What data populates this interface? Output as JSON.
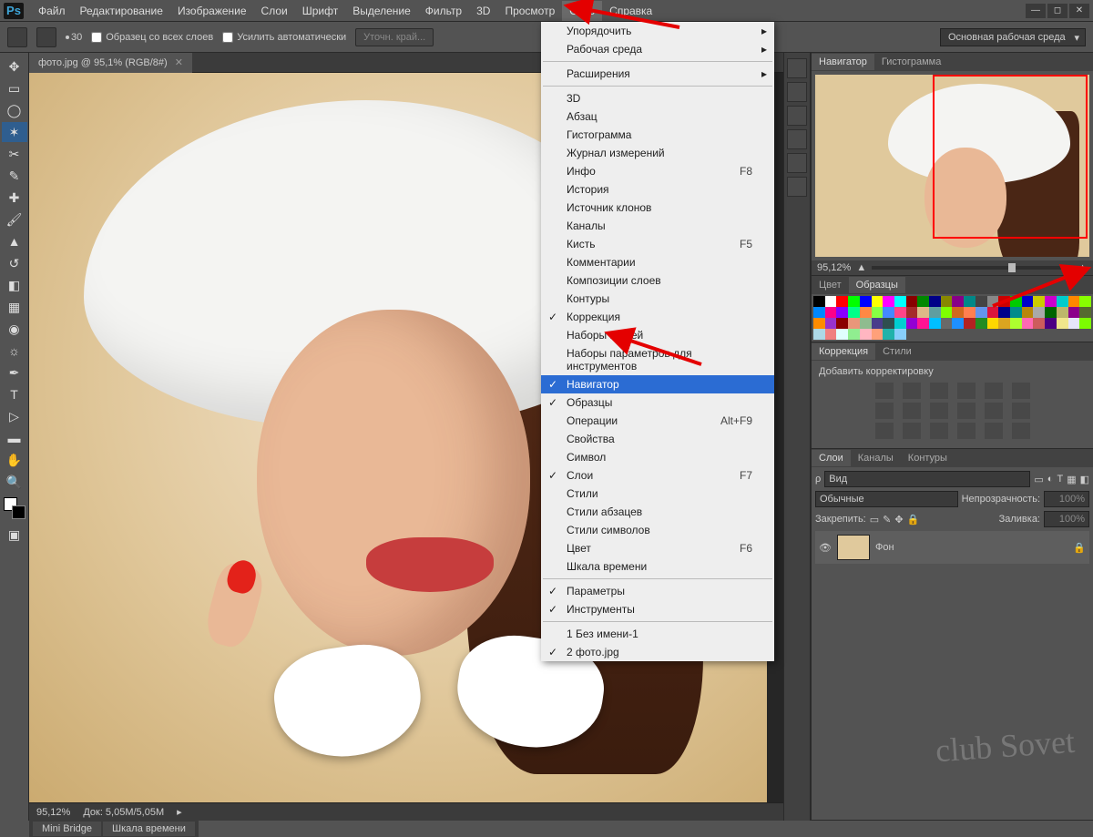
{
  "menu": [
    "Файл",
    "Редактирование",
    "Изображение",
    "Слои",
    "Шрифт",
    "Выделение",
    "Фильтр",
    "3D",
    "Просмотр",
    "Окно",
    "Справка"
  ],
  "active_menu_index": 9,
  "optbar": {
    "brush_size": "30",
    "chk1": "Образец со всех слоев",
    "chk2": "Усилить автоматически",
    "btn": "Уточн. край..."
  },
  "workspace": "Основная рабочая среда",
  "tab": {
    "title": "фото.jpg @ 95,1% (RGB/8#)"
  },
  "status": {
    "zoom": "95,12%",
    "doc": "Док:  5,05M/5,05M"
  },
  "dropdown": [
    {
      "t": "sub",
      "label": "Упорядочить"
    },
    {
      "t": "sub",
      "label": "Рабочая среда"
    },
    {
      "t": "sep"
    },
    {
      "t": "sub",
      "label": "Расширения"
    },
    {
      "t": "sep"
    },
    {
      "t": "item",
      "label": "3D"
    },
    {
      "t": "item",
      "label": "Абзац"
    },
    {
      "t": "item",
      "label": "Гистограмма"
    },
    {
      "t": "item",
      "label": "Журнал измерений"
    },
    {
      "t": "item",
      "label": "Инфо",
      "sc": "F8"
    },
    {
      "t": "item",
      "label": "История"
    },
    {
      "t": "item",
      "label": "Источник клонов"
    },
    {
      "t": "item",
      "label": "Каналы"
    },
    {
      "t": "item",
      "label": "Кисть",
      "sc": "F5"
    },
    {
      "t": "item",
      "label": "Комментарии"
    },
    {
      "t": "item",
      "label": "Композиции слоев"
    },
    {
      "t": "item",
      "label": "Контуры"
    },
    {
      "t": "chk",
      "label": "Коррекция"
    },
    {
      "t": "item",
      "label": "Наборы кистей"
    },
    {
      "t": "item",
      "label": "Наборы параметров для инструментов"
    },
    {
      "t": "hl chk",
      "label": "Навигатор"
    },
    {
      "t": "chk",
      "label": "Образцы"
    },
    {
      "t": "item",
      "label": "Операции",
      "sc": "Alt+F9"
    },
    {
      "t": "item",
      "label": "Свойства"
    },
    {
      "t": "item",
      "label": "Символ"
    },
    {
      "t": "chk",
      "label": "Слои",
      "sc": "F7"
    },
    {
      "t": "item",
      "label": "Стили"
    },
    {
      "t": "item",
      "label": "Стили абзацев"
    },
    {
      "t": "item",
      "label": "Стили символов"
    },
    {
      "t": "item",
      "label": "Цвет",
      "sc": "F6"
    },
    {
      "t": "item",
      "label": "Шкала времени"
    },
    {
      "t": "sep"
    },
    {
      "t": "chk",
      "label": "Параметры"
    },
    {
      "t": "chk",
      "label": "Инструменты"
    },
    {
      "t": "sep"
    },
    {
      "t": "item",
      "label": "1 Без имени-1"
    },
    {
      "t": "chk",
      "label": "2 фото.jpg"
    }
  ],
  "panels": {
    "nav": {
      "tabs": [
        "Навигатор",
        "Гистограмма"
      ],
      "zoom": "95,12%"
    },
    "color": {
      "tabs": [
        "Цвет",
        "Образцы"
      ]
    },
    "adj": {
      "tabs": [
        "Коррекция",
        "Стили"
      ],
      "title": "Добавить корректировку"
    },
    "layers": {
      "tabs": [
        "Слои",
        "Каналы",
        "Контуры"
      ],
      "filter": "Вид",
      "blend": "Обычные",
      "opacity_label": "Непрозрачность:",
      "opacity": "100%",
      "lock_label": "Закрепить:",
      "fill_label": "Заливка:",
      "fill": "100%",
      "layer_name": "Фон"
    }
  },
  "bottom_tabs": [
    "Mini Bridge",
    "Шкала времени"
  ],
  "watermark": "club Sovet",
  "swatch_colors": [
    "#000",
    "#fff",
    "#f00",
    "#0f0",
    "#00f",
    "#ff0",
    "#f0f",
    "#0ff",
    "#800",
    "#080",
    "#008",
    "#880",
    "#808",
    "#088",
    "#444",
    "#888",
    "#c00",
    "#0c0",
    "#00c",
    "#cc0",
    "#c0c",
    "#0cc",
    "#f80",
    "#8f0",
    "#08f",
    "#f08",
    "#80f",
    "#0f8",
    "#f84",
    "#8f4",
    "#48f",
    "#f48",
    "#a52a2a",
    "#deb887",
    "#5f9ea0",
    "#7fff00",
    "#d2691e",
    "#ff7f50",
    "#6495ed",
    "#dc143c",
    "#00008b",
    "#008b8b",
    "#b8860b",
    "#a9a9a9",
    "#006400",
    "#bdb76b",
    "#8b008b",
    "#556b2f",
    "#ff8c00",
    "#9932cc",
    "#8b0000",
    "#e9967a",
    "#8fbc8f",
    "#483d8b",
    "#2f4f4f",
    "#00ced1",
    "#9400d3",
    "#ff1493",
    "#00bfff",
    "#696969",
    "#1e90ff",
    "#b22222",
    "#228b22",
    "#ffd700",
    "#daa520",
    "#adff2f",
    "#ff69b4",
    "#cd5c5c",
    "#4b0082",
    "#f0e68c",
    "#e6e6fa",
    "#7cfc00",
    "#add8e6",
    "#f08080",
    "#e0ffff",
    "#90ee90",
    "#ffb6c1",
    "#ffa07a",
    "#20b2aa",
    "#87cefa"
  ]
}
